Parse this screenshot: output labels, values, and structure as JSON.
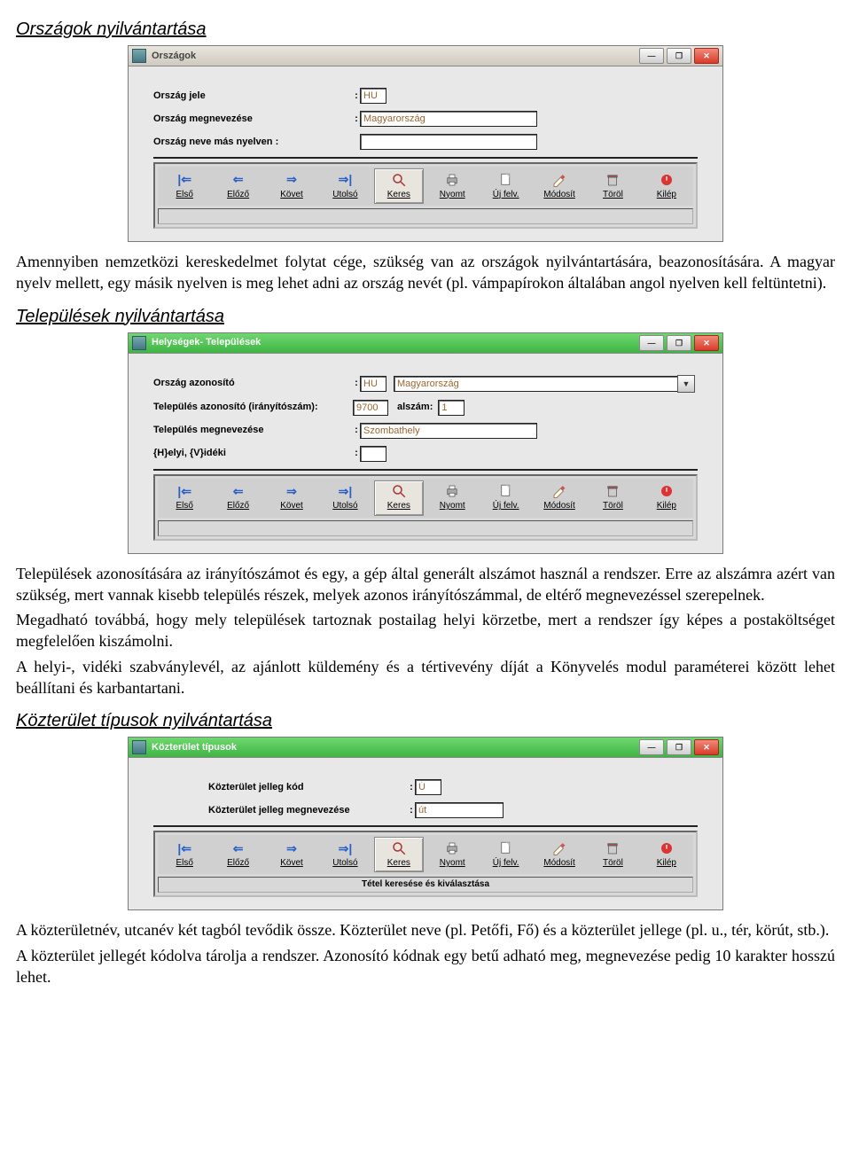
{
  "sections": {
    "orszagok_title": "Országok nyilvántartása",
    "telepulesek_title": "Települések nyilvántartása",
    "kozterulet_title": "Közterület típusok nyilvántartása"
  },
  "paragraphs": {
    "p1": "Amennyiben nemzetközi kereskedelmet folytat cége, szükség van az országok nyilvántartására, beazonosítására. A magyar nyelv mellett, egy másik nyelven is meg lehet adni az ország nevét (pl. vámpapírokon általában angol nyelven kell feltüntetni).",
    "p2a": "Települések azonosítására az irányítószámot és egy, a gép által generált alszámot használ a rendszer. Erre az alszámra azért van szükség, mert vannak kisebb település részek, melyek azonos irányítószámmal, de eltérő megnevezéssel szerepelnek.",
    "p2b": "Megadható továbbá, hogy mely települések tartoznak postailag helyi körzetbe, mert a rendszer így képes a postaköltséget megfelelően kiszámolni.",
    "p2c": "A helyi-, vidéki szabványlevél, az ajánlott küldemény és a tértivevény díját a Könyvelés modul paraméterei között lehet beállítani és karbantartani.",
    "p3a": "A közterületnév, utcanév két tagból tevődik össze. Közterület neve (pl. Petőfi, Fő) és a közterület jellege (pl. u., tér, körút, stb.).",
    "p3b": "A közterület jellegét kódolva tárolja a rendszer. Azonosító kódnak egy betű adható meg, megnevezése pedig 10 karakter hosszú lehet."
  },
  "win_countries": {
    "title": "Országok",
    "labels": {
      "orszag_jele": "Ország jele",
      "orszag_megnevezese": "Ország megnevezése",
      "orszag_neve_mas": "Ország neve más nyelven :"
    },
    "values": {
      "jele": "HU",
      "megnevezes": "Magyarország",
      "mas_nyelv": ""
    }
  },
  "win_places": {
    "title": "Helységek- Települések",
    "labels": {
      "orszag_azon": "Ország azonosító",
      "telep_azon": "Település azonosító (irányítószám):",
      "alszam": "alszám:",
      "telep_megnev": "Település megnevezése",
      "helyi_videki": "{H}elyi, {V}idéki"
    },
    "values": {
      "orszag_kod": "HU",
      "orszag_nev": "Magyarország",
      "iranyitoszam": "9700",
      "alszam": "1",
      "megnevezes": "Szombathely",
      "hv": ""
    }
  },
  "win_kozter": {
    "title": "Közterület típusok",
    "labels": {
      "kod": "Közterület jelleg kód",
      "megn": "Közterület jelleg megnevezése"
    },
    "values": {
      "kod": "Ú",
      "megn": "út"
    },
    "status": "Tétel keresése és kiválasztása"
  },
  "toolbar": {
    "elso": "Első",
    "elozo": "Előző",
    "kovet": "Követ",
    "utolso": "Utolsó",
    "keres": "Keres",
    "nyomt": "Nyomt",
    "ujfelv": "Új felv.",
    "modosit": "Módosít",
    "torol": "Töröl",
    "kilep": "Kilép"
  }
}
